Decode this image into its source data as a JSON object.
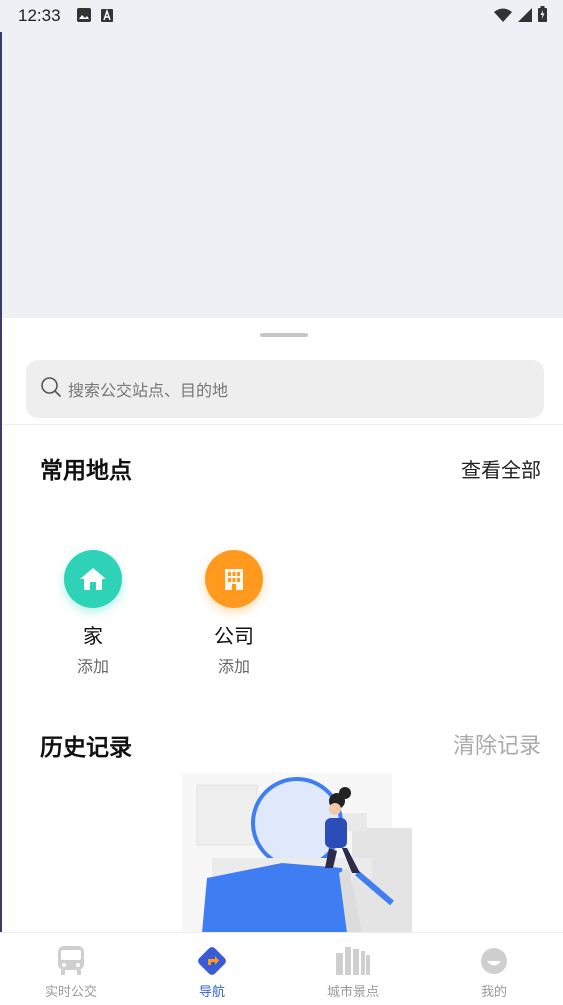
{
  "status_bar": {
    "time": "12:33",
    "icons": [
      "image-icon",
      "text-a-icon",
      "wifi-icon",
      "signal-icon",
      "battery-icon"
    ]
  },
  "search": {
    "placeholder": "搜索公交站点、目的地"
  },
  "frequent_places": {
    "title": "常用地点",
    "view_all": "查看全部",
    "items": [
      {
        "name": "家",
        "sub": "添加",
        "icon": "home-icon",
        "color": "#2ed3b7"
      },
      {
        "name": "公司",
        "sub": "添加",
        "icon": "building-icon",
        "color": "#ff9a1f"
      }
    ]
  },
  "history": {
    "title": "历史记录",
    "clear": "清除记录"
  },
  "tabs": [
    {
      "label": "实时公交",
      "icon": "bus-icon",
      "active": false
    },
    {
      "label": "导航",
      "icon": "navigation-icon",
      "active": true
    },
    {
      "label": "城市景点",
      "icon": "city-icon",
      "active": false
    },
    {
      "label": "我的",
      "icon": "profile-icon",
      "active": false
    }
  ],
  "colors": {
    "accent": "#2b5fd9",
    "tab_inactive": "#9a9a9a",
    "clear_text": "#aaaaaa"
  }
}
